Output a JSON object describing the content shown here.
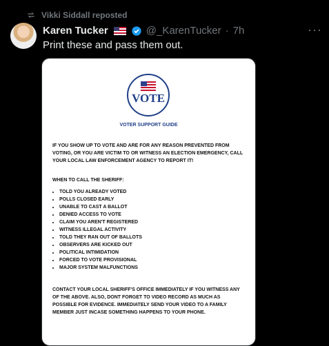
{
  "repost": {
    "text": "Vikki Siddall reposted",
    "icon": "repost-icon"
  },
  "tweet": {
    "author_name": "Karen Tucker",
    "handle": "@_KarenTucker",
    "separator": "·",
    "time": "7h",
    "more": "···",
    "text": "Print these and pass them out."
  },
  "media": {
    "logo_text": "VOTE",
    "guide_title": "VOTER SUPPORT GUIDE",
    "intro": "IF YOU SHOW UP TO VOTE AND ARE FOR ANY REASON PREVENTED FROM VOTING, OR YOU ARE VICTIM TO OR WITNESS AN ELECTION EMERGENCY, CALL YOUR LOCAL LAW ENFORCEMENT AGENCY TO REPORT IT!",
    "when_heading": "WHEN TO CALL THE SHERIFF:",
    "conditions": [
      "TOLD YOU ALREADY VOTED",
      "POLLS CLOSED EARLY",
      "UNABLE TO CAST A BALLOT",
      "DENIED ACCESS TO VOTE",
      "CLAIM YOU AREN'T REGISTERED",
      "WITNESS ILLEGAL ACTIVITY",
      "TOLD THEY RAN OUT OF BALLOTS",
      "OBSERVERS ARE KICKED OUT",
      "POLITICAL INTIMIDATION",
      "FORCED TO VOTE PROVISIONAL",
      "MAJOR SYSTEM MALFUNCTIONS"
    ],
    "contact": "CONTACT YOUR LOCAL SHERIFF'S OFFICE IMMEDIATELY IF YOU WITNESS ANY OF THE ABOVE. ALSO, DONT FORGET TO VIDEO RECORD AS MUCH AS POSSIBLE FOR EVIDENCE. IMMEDIATELY SEND YOUR VIDEO TO A FAMILY MEMBER JUST INCASE SOMETHING HAPPENS TO YOUR PHONE."
  },
  "colors": {
    "background": "#000000",
    "text": "#e7e9ea",
    "muted": "#71767b",
    "verified": "#1d9bf0",
    "vote_blue": "#1f3f88"
  }
}
